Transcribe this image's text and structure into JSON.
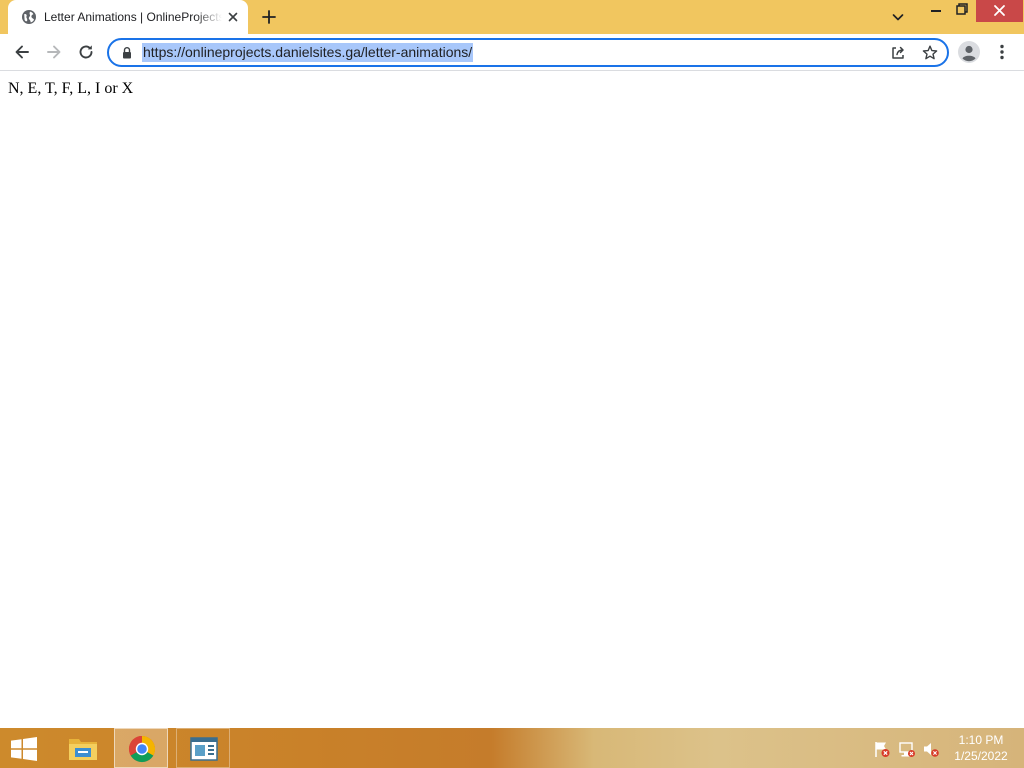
{
  "browser": {
    "tab": {
      "title": "Letter Animations | OnlineProjects",
      "favicon": "globe-icon"
    },
    "address_bar": {
      "url": "https://onlineprojects.danielsites.ga/letter-animations/",
      "selected": true
    },
    "accent_color": "#1a73e8",
    "frame_color": "#f1c65f"
  },
  "page": {
    "text": "N, E, T, F, L, I or X"
  },
  "taskbar": {
    "pinned": [
      "file-explorer-icon",
      "chrome-icon",
      "app-icon"
    ],
    "active": "chrome-icon",
    "clock": {
      "time": "1:10 PM",
      "date": "1/25/2022"
    }
  }
}
